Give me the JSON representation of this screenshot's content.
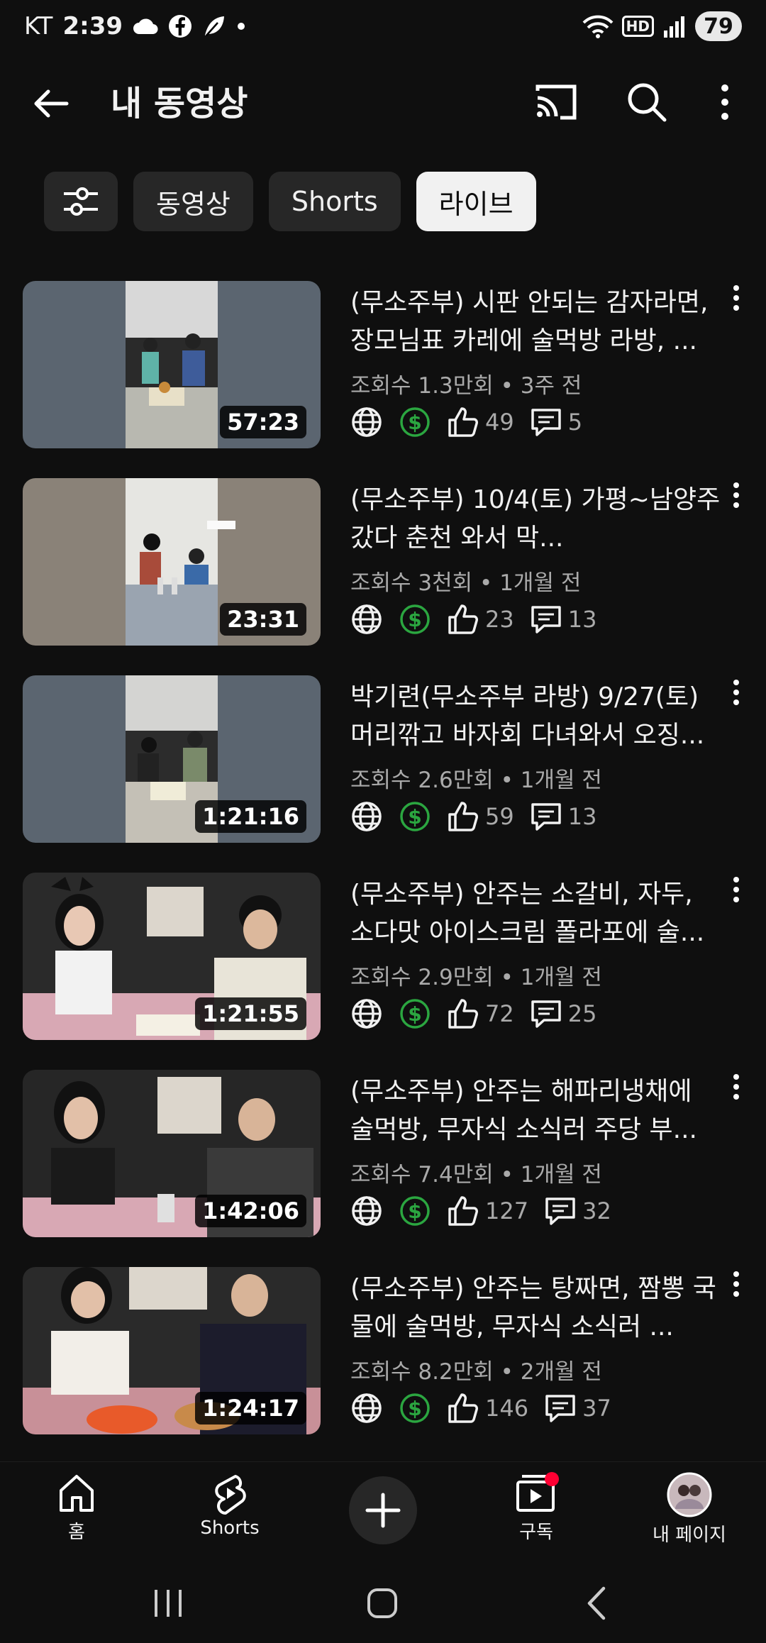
{
  "status_bar": {
    "carrier": "KT",
    "time": "2:39",
    "battery": "79",
    "hd_label": "HD"
  },
  "header": {
    "title": "내 동영상"
  },
  "chips": [
    {
      "label": "동영상",
      "active": false
    },
    {
      "label": "Shorts",
      "active": false
    },
    {
      "label": "라이브",
      "active": true
    }
  ],
  "videos": [
    {
      "title": "(무소주부) 시판 안되는 감자라면, 장모님표 카레에 술먹방 라방, ...",
      "duration": "57:23",
      "views": "조회수 1.3만회",
      "age": "3주 전",
      "likes": "49",
      "comments": "5"
    },
    {
      "title": "(무소주부) 10/4(토) 가평~남양주 갔다 춘천 와서 막...",
      "duration": "23:31",
      "views": "조회수 3천회",
      "age": "1개월 전",
      "likes": "23",
      "comments": "13"
    },
    {
      "title": "박기련(무소주부 라방) 9/27(토) 머리깎고 바자회 다녀와서 오징...",
      "duration": "1:21:16",
      "views": "조회수 2.6만회",
      "age": "1개월 전",
      "likes": "59",
      "comments": "13"
    },
    {
      "title": "(무소주부) 안주는 소갈비, 자두, 소다맛 아이스크림 폴라포에 술...",
      "duration": "1:21:55",
      "views": "조회수 2.9만회",
      "age": "1개월 전",
      "likes": "72",
      "comments": "25"
    },
    {
      "title": "(무소주부) 안주는 해파리냉채에 술먹방, 무자식 소식러 주당 부...",
      "duration": "1:42:06",
      "views": "조회수 7.4만회",
      "age": "1개월 전",
      "likes": "127",
      "comments": "32"
    },
    {
      "title": "(무소주부) 안주는 탕짜면, 짬뽕 국물에 술먹방, 무자식 소식러 ...",
      "duration": "1:24:17",
      "views": "조회수 8.2만회",
      "age": "2개월 전",
      "likes": "146",
      "comments": "37"
    }
  ],
  "meta_separator": "•",
  "bottom_nav": {
    "home": "홈",
    "shorts": "Shorts",
    "subscriptions": "구독",
    "my_page": "내 페이지"
  },
  "colors": {
    "background": "#0f0f0f",
    "chip_bg": "#272727",
    "chip_active_bg": "#f1f1f1",
    "monetization_green": "#2ba640",
    "notification_red": "#ff0033",
    "secondary_text": "#aaaaaa"
  },
  "icons": [
    "back-arrow-icon",
    "cast-icon",
    "search-icon",
    "more-vert-icon",
    "filter-icon",
    "globe-icon",
    "dollar-icon",
    "thumb-up-icon",
    "comment-icon",
    "home-icon",
    "shorts-icon",
    "plus-icon",
    "subscriptions-icon"
  ]
}
